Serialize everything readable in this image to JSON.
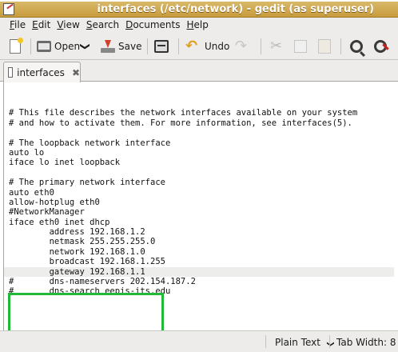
{
  "window": {
    "title": "interfaces (/etc/network) - gedit (as superuser)"
  },
  "menu": [
    "File",
    "Edit",
    "View",
    "Search",
    "Documents",
    "Help"
  ],
  "toolbar": {
    "open_label": "Open",
    "save_label": "Save",
    "undo_label": "Undo",
    "dropdown_glyph": "❯"
  },
  "tab": {
    "label": "interfaces",
    "close_glyph": "✖"
  },
  "editor": {
    "lines": [
      "",
      "# This file describes the network interfaces available on your system",
      "# and how to activate them. For more information, see interfaces(5).",
      "",
      "# The loopback network interface",
      "auto lo",
      "iface lo inet loopback",
      "",
      "# The primary network interface",
      "auto eth0",
      "allow-hotplug eth0",
      "#NetworkManager",
      "iface eth0 inet dhcp",
      "        address 192.168.1.2",
      "        netmask 255.255.255.0",
      "        network 192.168.1.0",
      "        broadcast 192.168.1.255",
      "        gateway 192.168.1.1",
      "#       dns-nameservers 202.154.187.2",
      "#       dns-search eepis-its.edu"
    ],
    "current_line_index": 17
  },
  "colors": {
    "highlight_box": "#22b83a",
    "titlebar": "#c89b3c"
  },
  "statusbar": {
    "language": "Plain Text",
    "tab_width": "Tab Width: 8"
  }
}
